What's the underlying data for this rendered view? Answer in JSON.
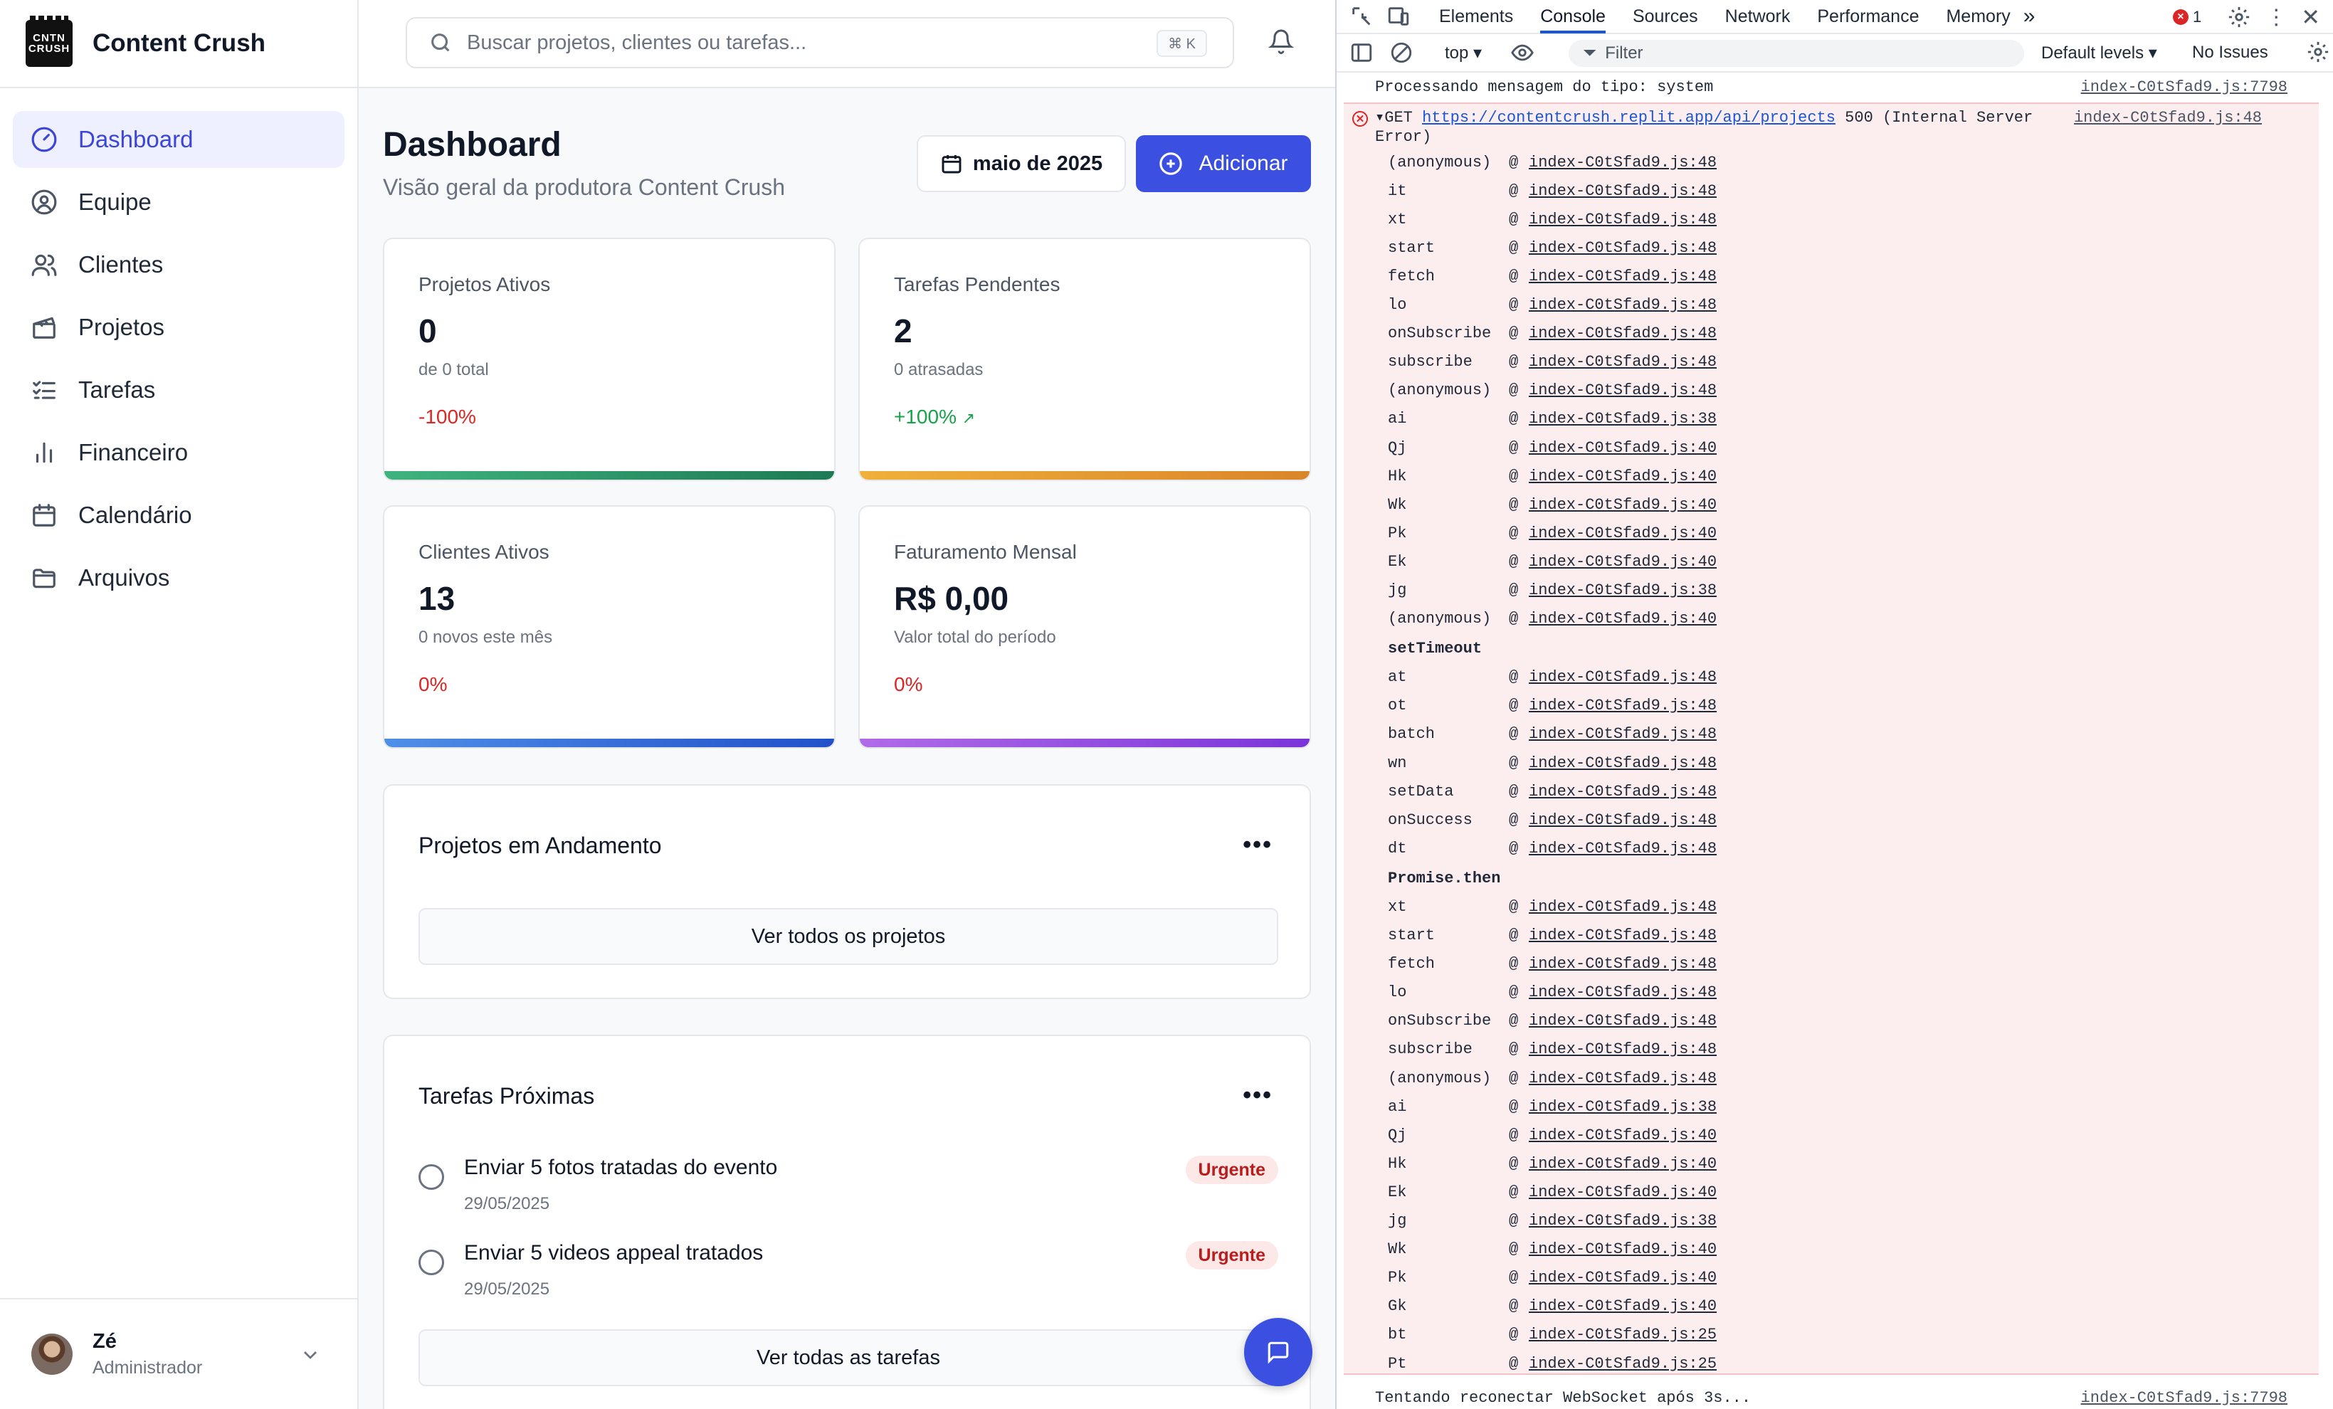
{
  "app": {
    "brand_name": "Content Crush",
    "logo_text_top": "CNTN",
    "logo_text_bottom": "CRUSH"
  },
  "sidebar": {
    "items": [
      {
        "label": "Dashboard",
        "icon": "gauge-icon",
        "active": true
      },
      {
        "label": "Equipe",
        "icon": "user-circle-icon"
      },
      {
        "label": "Clientes",
        "icon": "users-icon"
      },
      {
        "label": "Projetos",
        "icon": "clapperboard-icon"
      },
      {
        "label": "Tarefas",
        "icon": "list-checks-icon"
      },
      {
        "label": "Financeiro",
        "icon": "bar-chart-icon"
      },
      {
        "label": "Calendário",
        "icon": "calendar-icon"
      },
      {
        "label": "Arquivos",
        "icon": "folder-icon"
      }
    ],
    "user": {
      "name": "Zé",
      "role": "Administrador"
    }
  },
  "topbar": {
    "search_placeholder": "Buscar projetos, clientes ou tarefas...",
    "search_shortcut": "⌘ K"
  },
  "header": {
    "title": "Dashboard",
    "subtitle": "Visão geral da produtora Content Crush",
    "month_label": "maio de 2025",
    "add_label": "Adicionar"
  },
  "stats": [
    {
      "label": "Projetos Ativos",
      "value": "0",
      "sub": "de 0 total",
      "trend": "-100%",
      "trend_color": "#dc2626",
      "bar": [
        "#3fb37f",
        "#1e7a52"
      ]
    },
    {
      "label": "Tarefas Pendentes",
      "value": "2",
      "sub": "0 atrasadas",
      "trend": "+100%",
      "trend_arrow": "↗",
      "trend_color": "#16a34a",
      "bar": [
        "#f0b03a",
        "#d9852a"
      ]
    },
    {
      "label": "Clientes Ativos",
      "value": "13",
      "sub": "0 novos este mês",
      "trend": "0%",
      "trend_color": "#dc2626",
      "bar": [
        "#4f8fe8",
        "#2250c9"
      ]
    },
    {
      "label": "Faturamento Mensal",
      "value": "R$ 0,00",
      "sub": "Valor total do período",
      "trend": "0%",
      "trend_color": "#dc2626",
      "bar": [
        "#b06be8",
        "#7a35d9"
      ]
    }
  ],
  "projects_section": {
    "title": "Projetos em Andamento",
    "view_all": "Ver todos os projetos"
  },
  "tasks_section": {
    "title": "Tarefas Próximas",
    "view_all": "Ver todas as tarefas",
    "tasks": [
      {
        "title": "Enviar 5 fotos tratadas do evento",
        "date": "29/05/2025",
        "badge": "Urgente"
      },
      {
        "title": "Enviar 5 videos appeal tratados",
        "date": "29/05/2025",
        "badge": "Urgente"
      }
    ]
  },
  "devtools": {
    "tabs": [
      "Elements",
      "Console",
      "Sources",
      "Network",
      "Performance",
      "Memory"
    ],
    "active_tab": "Console",
    "more_tabs": "»",
    "error_count": "1",
    "context": "top ▾",
    "filter_placeholder": "Filter",
    "levels": "Default levels ▾",
    "issues": "No Issues",
    "log_top": {
      "text": "Processando mensagem do tipo: system",
      "src": "index-C0tSfad9.js:7798"
    },
    "error": {
      "method": "▾GET",
      "url": "https://contentcrush.replit.app/api/projects",
      "status": "500 (Internal Server",
      "status2": "Error)",
      "src": "index-C0tSfad9.js:48"
    },
    "stack": [
      {
        "fn": "(anonymous)",
        "src": "index-C0tSfad9.js:48"
      },
      {
        "fn": "it",
        "src": "index-C0tSfad9.js:48"
      },
      {
        "fn": "xt",
        "src": "index-C0tSfad9.js:48"
      },
      {
        "fn": "start",
        "src": "index-C0tSfad9.js:48"
      },
      {
        "fn": "fetch",
        "src": "index-C0tSfad9.js:48"
      },
      {
        "fn": "lo",
        "src": "index-C0tSfad9.js:48"
      },
      {
        "fn": "onSubscribe",
        "src": "index-C0tSfad9.js:48"
      },
      {
        "fn": "subscribe",
        "src": "index-C0tSfad9.js:48"
      },
      {
        "fn": "(anonymous)",
        "src": "index-C0tSfad9.js:48"
      },
      {
        "fn": "ai",
        "src": "index-C0tSfad9.js:38"
      },
      {
        "fn": "Qj",
        "src": "index-C0tSfad9.js:40"
      },
      {
        "fn": "Hk",
        "src": "index-C0tSfad9.js:40"
      },
      {
        "fn": "Wk",
        "src": "index-C0tSfad9.js:40"
      },
      {
        "fn": "Pk",
        "src": "index-C0tSfad9.js:40"
      },
      {
        "fn": "Ek",
        "src": "index-C0tSfad9.js:40"
      },
      {
        "fn": "jg",
        "src": "index-C0tSfad9.js:38"
      },
      {
        "fn": "(anonymous)",
        "src": "index-C0tSfad9.js:40"
      },
      {
        "group": "setTimeout"
      },
      {
        "fn": "at",
        "src": "index-C0tSfad9.js:48"
      },
      {
        "fn": "ot",
        "src": "index-C0tSfad9.js:48"
      },
      {
        "fn": "batch",
        "src": "index-C0tSfad9.js:48"
      },
      {
        "fn": "wn",
        "src": "index-C0tSfad9.js:48"
      },
      {
        "fn": "setData",
        "src": "index-C0tSfad9.js:48"
      },
      {
        "fn": "onSuccess",
        "src": "index-C0tSfad9.js:48"
      },
      {
        "fn": "dt",
        "src": "index-C0tSfad9.js:48"
      },
      {
        "group": "Promise.then"
      },
      {
        "fn": "xt",
        "src": "index-C0tSfad9.js:48"
      },
      {
        "fn": "start",
        "src": "index-C0tSfad9.js:48"
      },
      {
        "fn": "fetch",
        "src": "index-C0tSfad9.js:48"
      },
      {
        "fn": "lo",
        "src": "index-C0tSfad9.js:48"
      },
      {
        "fn": "onSubscribe",
        "src": "index-C0tSfad9.js:48"
      },
      {
        "fn": "subscribe",
        "src": "index-C0tSfad9.js:48"
      },
      {
        "fn": "(anonymous)",
        "src": "index-C0tSfad9.js:48"
      },
      {
        "fn": "ai",
        "src": "index-C0tSfad9.js:38"
      },
      {
        "fn": "Qj",
        "src": "index-C0tSfad9.js:40"
      },
      {
        "fn": "Hk",
        "src": "index-C0tSfad9.js:40"
      },
      {
        "fn": "Ek",
        "src": "index-C0tSfad9.js:40"
      },
      {
        "fn": "jg",
        "src": "index-C0tSfad9.js:38"
      },
      {
        "fn": "Wk",
        "src": "index-C0tSfad9.js:40"
      },
      {
        "fn": "Pk",
        "src": "index-C0tSfad9.js:40"
      },
      {
        "fn": "Gk",
        "src": "index-C0tSfad9.js:40"
      },
      {
        "fn": "bt",
        "src": "index-C0tSfad9.js:25"
      },
      {
        "fn": "Pt",
        "src": "index-C0tSfad9.js:25"
      }
    ],
    "log_bottom": {
      "text": "Tentando reconectar WebSocket após 3s...",
      "src": "index-C0tSfad9.js:7798"
    }
  }
}
